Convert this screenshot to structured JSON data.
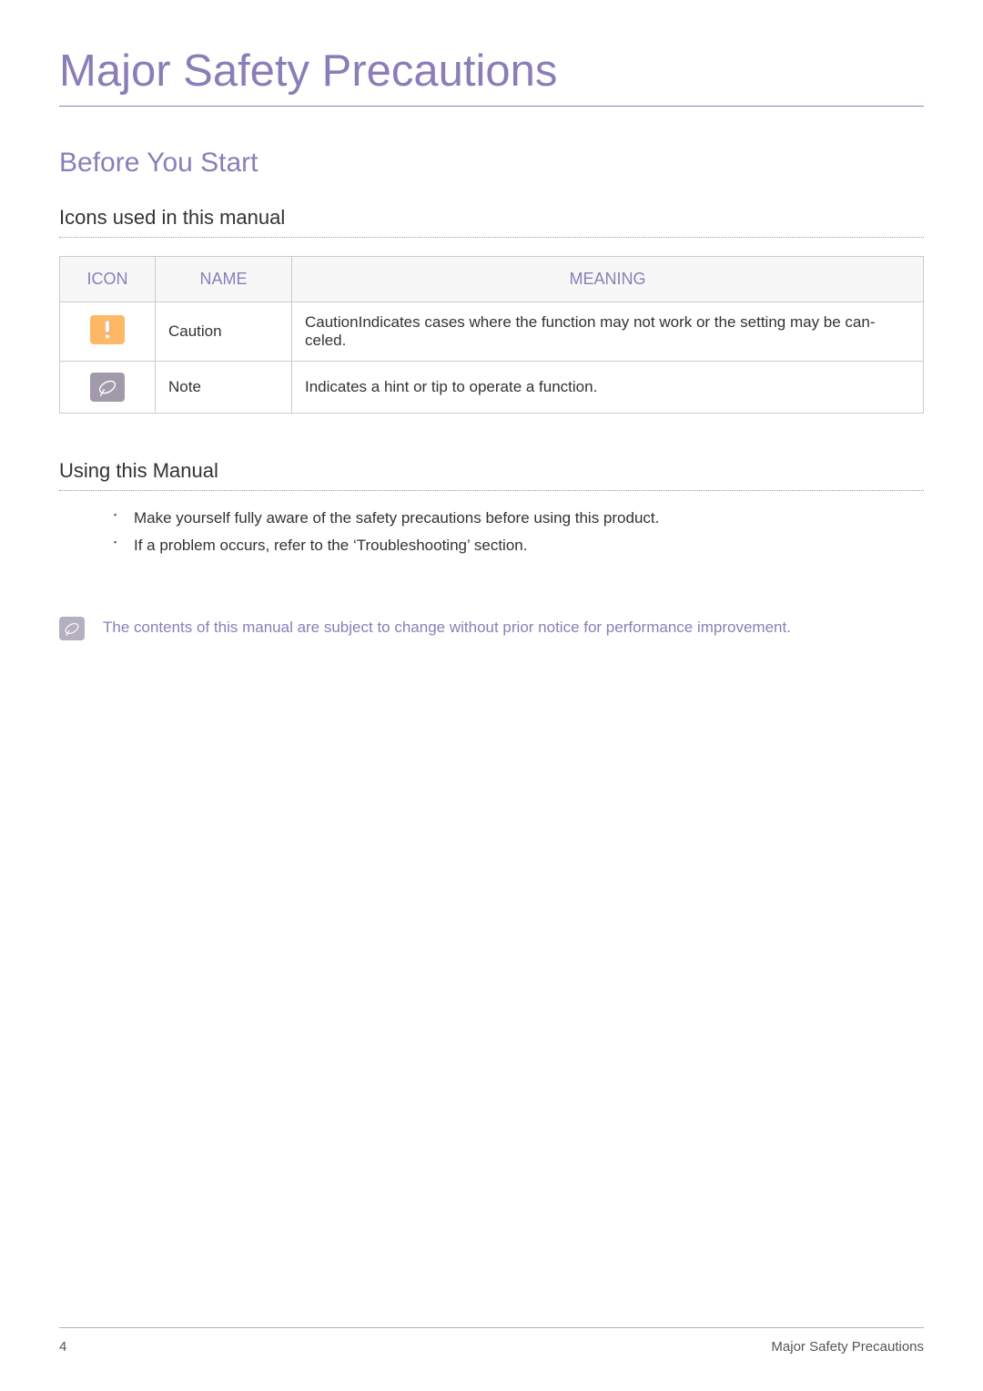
{
  "page_title": "Major Safety Precautions",
  "section_title": "Before You Start",
  "icons_section": {
    "heading": "Icons used in this manual",
    "headers": {
      "icon": "ICON",
      "name": "NAME",
      "meaning": "MEANING"
    },
    "rows": [
      {
        "name": "Caution",
        "meaning": "CautionIndicates cases where the function may not work or the setting may be can­celed."
      },
      {
        "name": "Note",
        "meaning": "Indicates a hint or tip to operate a function."
      }
    ]
  },
  "using_section": {
    "heading": "Using this Manual",
    "bullets": [
      "Make yourself fully aware of the safety precautions before using this product.",
      "If a problem occurs, refer to the ‘Troubleshooting’ section."
    ]
  },
  "note_callout": "The contents of this manual are subject to change without prior notice for performance improvement.",
  "footer": {
    "page_number": "4",
    "section_label": "Major Safety Precautions"
  }
}
